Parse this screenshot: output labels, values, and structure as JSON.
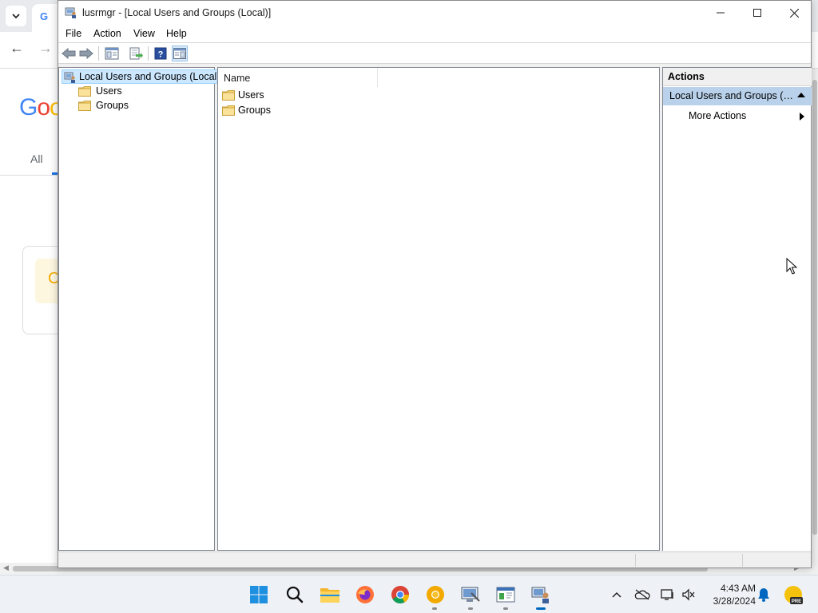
{
  "window": {
    "title": "lusrmgr - [Local Users and Groups (Local)]",
    "controls": {
      "minimize": "—",
      "maximize": "☐",
      "close": "✕"
    }
  },
  "menu": [
    "File",
    "Action",
    "View",
    "Help"
  ],
  "toolbar": {
    "buttons": [
      "back-arrow-icon",
      "forward-arrow-icon",
      "show-hide-console-tree-icon",
      "export-list-icon",
      "help-icon",
      "show-hide-action-pane-icon"
    ]
  },
  "tree": {
    "root": "Local Users and Groups (Local)",
    "children": [
      "Users",
      "Groups"
    ]
  },
  "list": {
    "column": "Name",
    "items": [
      "Users",
      "Groups"
    ]
  },
  "actions": {
    "header": "Actions",
    "section": "Local Users and Groups (Local)",
    "more": "More Actions"
  },
  "browser": {
    "logo_partial": "Goo",
    "tab_all": "All",
    "card_letter": "C"
  },
  "taskbar": {
    "apps": [
      "start-icon",
      "search-icon",
      "file-explorer-icon",
      "firefox-icon",
      "chrome-icon",
      "chrome-canary-icon",
      "computer-management-icon",
      "event-viewer-icon",
      "lusrmgr-icon"
    ],
    "time": "4:43 AM",
    "date": "3/28/2024",
    "tray": [
      "chevron-up-icon",
      "onedrive-offline-icon",
      "display-network-icon",
      "volume-mute-icon",
      "notification-bell-icon",
      "copilot-pre-icon"
    ]
  },
  "colors": {
    "selection": "#cce8ff",
    "action_highlight": "#b9d1ea",
    "accent": "#0067c0"
  }
}
